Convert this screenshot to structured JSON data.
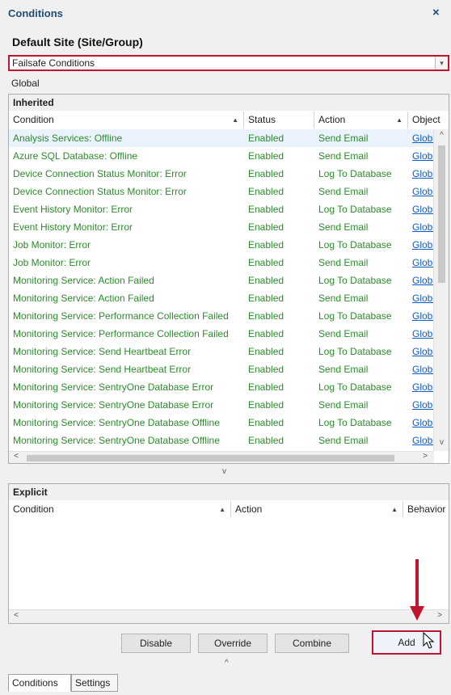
{
  "window": {
    "title": "Conditions",
    "close_glyph": "×"
  },
  "site_title": "Default Site (Site/Group)",
  "dropdown": {
    "value": "Failsafe Conditions",
    "arrow_glyph": "▾"
  },
  "scope_label": "Global",
  "inherited": {
    "heading": "Inherited",
    "columns": [
      "Condition",
      "Status",
      "Action",
      "Object"
    ],
    "sort_glyph": "▲",
    "rows": [
      [
        "Analysis Services: Offline",
        "Enabled",
        "Send Email",
        "Global"
      ],
      [
        "Azure SQL Database: Offline",
        "Enabled",
        "Send Email",
        "Global"
      ],
      [
        "Device Connection Status Monitor: Error",
        "Enabled",
        "Log To Database",
        "Global"
      ],
      [
        "Device Connection Status Monitor: Error",
        "Enabled",
        "Send Email",
        "Global"
      ],
      [
        "Event History Monitor: Error",
        "Enabled",
        "Log To Database",
        "Global"
      ],
      [
        "Event History Monitor: Error",
        "Enabled",
        "Send Email",
        "Global"
      ],
      [
        "Job Monitor: Error",
        "Enabled",
        "Log To Database",
        "Global"
      ],
      [
        "Job Monitor: Error",
        "Enabled",
        "Send Email",
        "Global"
      ],
      [
        "Monitoring Service: Action Failed",
        "Enabled",
        "Log To Database",
        "Global"
      ],
      [
        "Monitoring Service: Action Failed",
        "Enabled",
        "Send Email",
        "Global"
      ],
      [
        "Monitoring Service: Performance Collection Failed",
        "Enabled",
        "Log To Database",
        "Global"
      ],
      [
        "Monitoring Service: Performance Collection Failed",
        "Enabled",
        "Send Email",
        "Global"
      ],
      [
        "Monitoring Service: Send Heartbeat Error",
        "Enabled",
        "Log To Database",
        "Global"
      ],
      [
        "Monitoring Service: Send Heartbeat Error",
        "Enabled",
        "Send Email",
        "Global"
      ],
      [
        "Monitoring Service: SentryOne Database Error",
        "Enabled",
        "Log To Database",
        "Global"
      ],
      [
        "Monitoring Service: SentryOne Database Error",
        "Enabled",
        "Send Email",
        "Global"
      ],
      [
        "Monitoring Service: SentryOne Database Offline",
        "Enabled",
        "Log To Database",
        "Global"
      ],
      [
        "Monitoring Service: SentryOne Database Offline",
        "Enabled",
        "Send Email",
        "Global"
      ]
    ],
    "scroll": {
      "up": "^",
      "down": "v",
      "left": "<",
      "right": ">"
    }
  },
  "splitter_down": "v",
  "explicit": {
    "heading": "Explicit",
    "columns": [
      "Condition",
      "Action",
      "Behavior"
    ],
    "sort_glyph": "▲"
  },
  "buttons": {
    "disable": "Disable",
    "override": "Override",
    "combine": "Combine",
    "add": "Add"
  },
  "splitter_up": "^",
  "tabs": [
    {
      "label": "Conditions",
      "active": true
    },
    {
      "label": "Settings",
      "active": false
    }
  ],
  "colors": {
    "highlight": "#c0152f",
    "condition_text": "#2e8b2e",
    "link": "#0a5fc8",
    "title": "#1f4e79"
  }
}
